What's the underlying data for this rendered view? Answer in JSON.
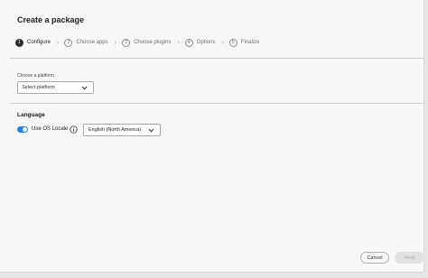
{
  "dialog": {
    "title": "Create a package"
  },
  "steps": [
    {
      "number": "1",
      "label": "Configure",
      "active": true
    },
    {
      "number": "2",
      "label": "Choose apps",
      "active": false
    },
    {
      "number": "3",
      "label": "Choose plugins",
      "active": false
    },
    {
      "number": "4",
      "label": "Options",
      "active": false
    },
    {
      "number": "5",
      "label": "Finalize",
      "active": false
    }
  ],
  "platform": {
    "label": "Choose a platform",
    "placeholder": "Select platform",
    "icon": "chevron-down-icon"
  },
  "language": {
    "section_title": "Language",
    "toggle_label": "Use OS Locale",
    "toggle_on": true,
    "toggle_color": "#2680eb",
    "info_icon": "info-icon",
    "locale_value": "English (North America)",
    "locale_icon": "chevron-down-icon"
  },
  "footer": {
    "cancel_label": "Cancel",
    "next_label": "Next"
  }
}
